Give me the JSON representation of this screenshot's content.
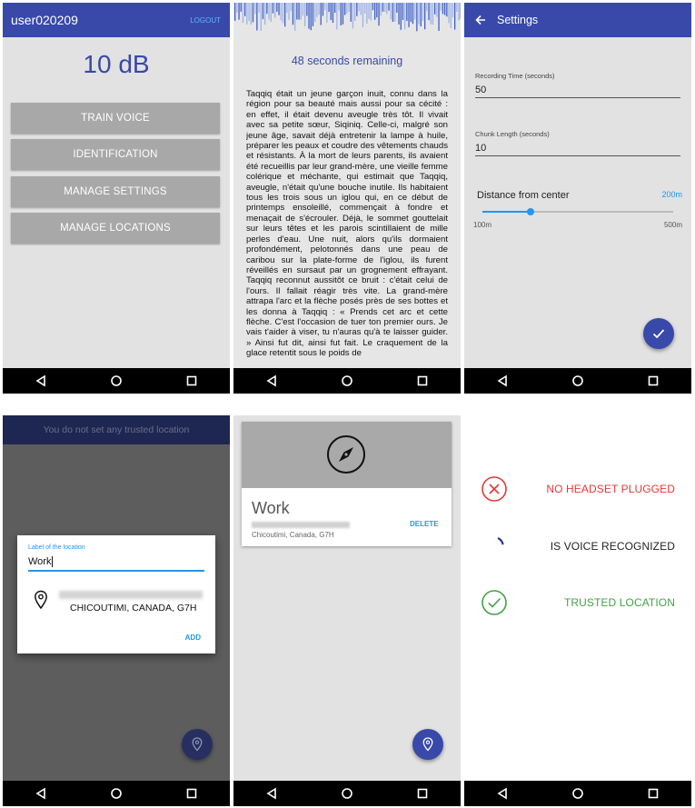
{
  "screen1": {
    "username": "user020209",
    "logout_label": "LOGOUT",
    "db_reading": "10 dB",
    "buttons": [
      "TRAIN VOICE",
      "IDENTIFICATION",
      "MANAGE SETTINGS",
      "MANAGE LOCATIONS"
    ]
  },
  "screen2": {
    "countdown": "48 seconds remaining",
    "story_text": "Taqqiq était un jeune garçon inuit, connu dans la région pour sa beauté mais aussi pour sa cécité : en effet, il était devenu aveugle très tôt. Il vivait avec sa petite sœur, Siqiniq. Celle-ci, malgré son jeune âge, savait déjà entretenir la lampe à huile, préparer les peaux et coudre des vêtements chauds et résistants. À la mort de leurs parents, ils avaient été recueillis par leur grand-mère, une vieille femme colérique et méchante, qui estimait que Taqqiq, aveugle, n'était qu'une bouche inutile. Ils habitaient tous les trois sous un iglou qui, en ce début de printemps ensoleillé, commençait à fondre et menaçait de s'écrouler. Déjà, le sommet gouttelait sur leurs têtes et les parois scintillaient de mille perles d'eau. Une nuit, alors qu'ils dormaient profondément, pelotonnés dans une peau de caribou sur la plate-forme de l'iglou, ils furent réveillés en sursaut par un grognement effrayant. Taqqiq reconnut aussitôt ce bruit : c'était celui de l'ours. Il fallait réagir très vite. La grand-mère attrapa l'arc et la flèche posés près de ses bottes et les donna à Taqqiq : « Prends cet arc et cette flèche. C'est l'occasion de tuer ton premier ours. Je vais t'aider à viser, tu n'auras qu'à te laisser guider. » Ainsi fut dit, ainsi fut fait. Le craquement de la glace retentit sous le poids de"
  },
  "screen3": {
    "title": "Settings",
    "recording_time_label": "Recording Time (seconds)",
    "recording_time_value": "50",
    "chunk_length_label": "Chunk Length (seconds)",
    "chunk_length_value": "10",
    "distance_label": "Distance from center",
    "distance_value": "200m",
    "slider_min": "100m",
    "slider_max": "500m",
    "slider_fraction": 0.25
  },
  "screen4": {
    "banner": "You do not set any trusted location",
    "dialog_label": "Label of the location",
    "dialog_value": "Work",
    "address_line2": "CHICOUTIMI, CANADA, G7H",
    "add_label": "ADD"
  },
  "screen5": {
    "location_name": "Work",
    "address_line2": "Chicoutimi, Canada, G7H",
    "delete_label": "DELETE"
  },
  "screen6": {
    "status_items": [
      {
        "label": "NO HEADSET PLUGGED",
        "icon": "error-circle-icon",
        "color": "#e53935"
      },
      {
        "label": "IS VOICE RECOGNIZED",
        "icon": "loading-spinner-icon",
        "color": "#222222"
      },
      {
        "label": "TRUSTED LOCATION",
        "icon": "check-circle-icon",
        "color": "#43a047"
      }
    ]
  },
  "colors": {
    "primary": "#3849aa",
    "accent": "#2196f3",
    "error": "#e53935",
    "success": "#43a047"
  }
}
